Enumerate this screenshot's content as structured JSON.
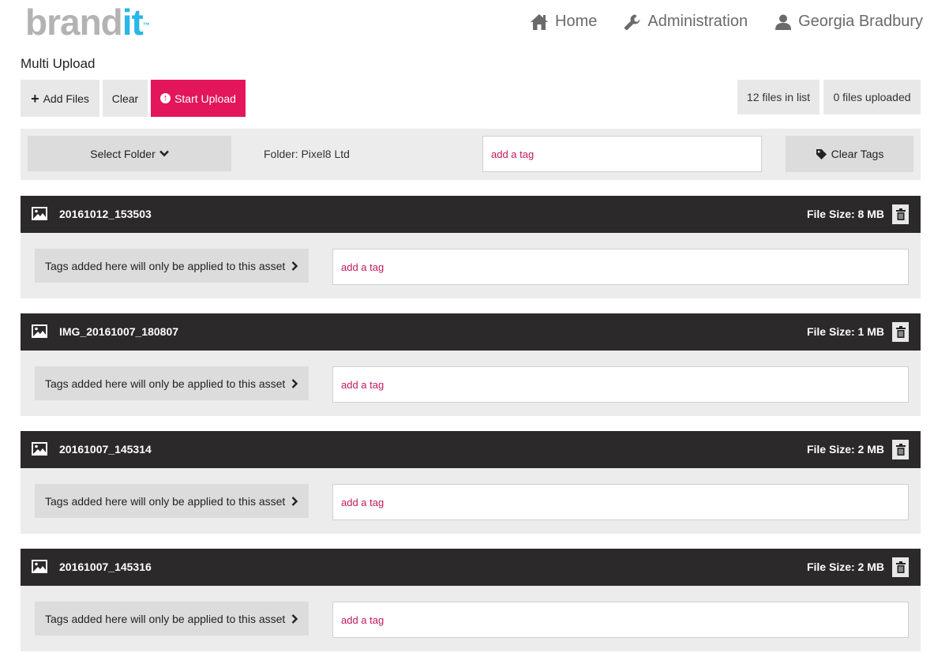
{
  "logo": {
    "brand": "brand",
    "it": "it",
    "tm": "™"
  },
  "nav": {
    "home": "Home",
    "administration": "Administration",
    "user": "Georgia Bradbury"
  },
  "page_title": "Multi Upload",
  "toolbar": {
    "add_files": "Add Files",
    "clear": "Clear",
    "start_upload": "Start Upload",
    "files_in_list": "12 files in list",
    "files_uploaded": "0 files uploaded"
  },
  "folder_bar": {
    "select_folder": "Select Folder",
    "folder_label": "Folder: Pixel8 Ltd",
    "tag_placeholder": "add a tag",
    "clear_tags": "Clear Tags"
  },
  "files": [
    {
      "name": "20161012_153503",
      "size": "File Size: 8 MB",
      "note": "Tags added here will only be applied to this asset",
      "tag_placeholder": "add a tag"
    },
    {
      "name": "IMG_20161007_180807",
      "size": "File Size: 1 MB",
      "note": "Tags added here will only be applied to this asset",
      "tag_placeholder": "add a tag"
    },
    {
      "name": "20161007_145314",
      "size": "File Size: 2 MB",
      "note": "Tags added here will only be applied to this asset",
      "tag_placeholder": "add a tag"
    },
    {
      "name": "20161007_145316",
      "size": "File Size: 2 MB",
      "note": "Tags added here will only be applied to this asset",
      "tag_placeholder": "add a tag"
    }
  ],
  "colors": {
    "accent": "#e3165b",
    "header_dark": "#2b2929",
    "logo_grey": "#b3b3b3",
    "logo_blue": "#29b6e8",
    "panel_bg": "#ececec"
  },
  "icons": {
    "home": "home-icon",
    "administration": "wrench-icon",
    "user": "user-icon",
    "add": "plus-icon",
    "start": "upload-circle-icon",
    "select_folder": "chevron-down-icon",
    "clear_tags": "tag-icon",
    "file": "image-icon",
    "delete": "trash-icon",
    "note": "chevron-right-icon"
  }
}
